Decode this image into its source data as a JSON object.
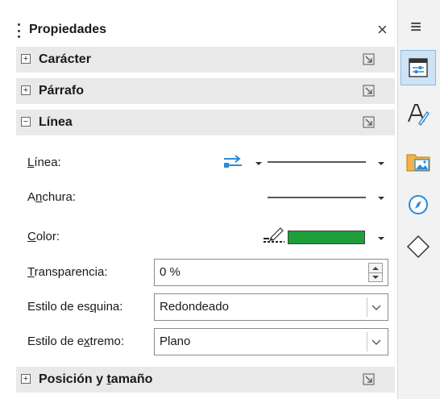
{
  "panel": {
    "title": "Propiedades",
    "close_glyph": "×"
  },
  "sections": {
    "caracter": "Carácter",
    "parrafo": "Párrafo",
    "linea": "Línea",
    "posicion": {
      "pre": "Posición y ",
      "u": "t",
      "post": "amaño"
    }
  },
  "expander": {
    "collapsed": "+",
    "expanded": "−"
  },
  "linea": {
    "linea_label": {
      "u": "L",
      "post": "ínea:"
    },
    "anchura_label": {
      "pre": "A",
      "u": "n",
      "post": "chura:"
    },
    "color_label": {
      "u": "C",
      "post": "olor:"
    },
    "color_value": "#1e9e3a",
    "transparencia_label": {
      "u": "T",
      "post": "ransparencia:"
    },
    "transparencia_value": "0 %",
    "esquina_label": {
      "pre": "Estilo de es",
      "u": "q",
      "post": "uina:"
    },
    "esquina_value": "Redondeado",
    "extremo_label": {
      "pre": "Estilo de e",
      "u": "x",
      "post": "tremo:"
    },
    "extremo_value": "Plano"
  },
  "tabbar": {
    "menu_glyph": "≡",
    "items": [
      "properties-icon",
      "styles-icon",
      "gallery-icon",
      "navigator-icon",
      "shapes-icon"
    ]
  },
  "colors": {
    "accent": "#1e9e3a",
    "section_bg": "#e9e9e9",
    "active_tab": "#cfe3f7",
    "arrows_blue": "#2a8ad8"
  }
}
